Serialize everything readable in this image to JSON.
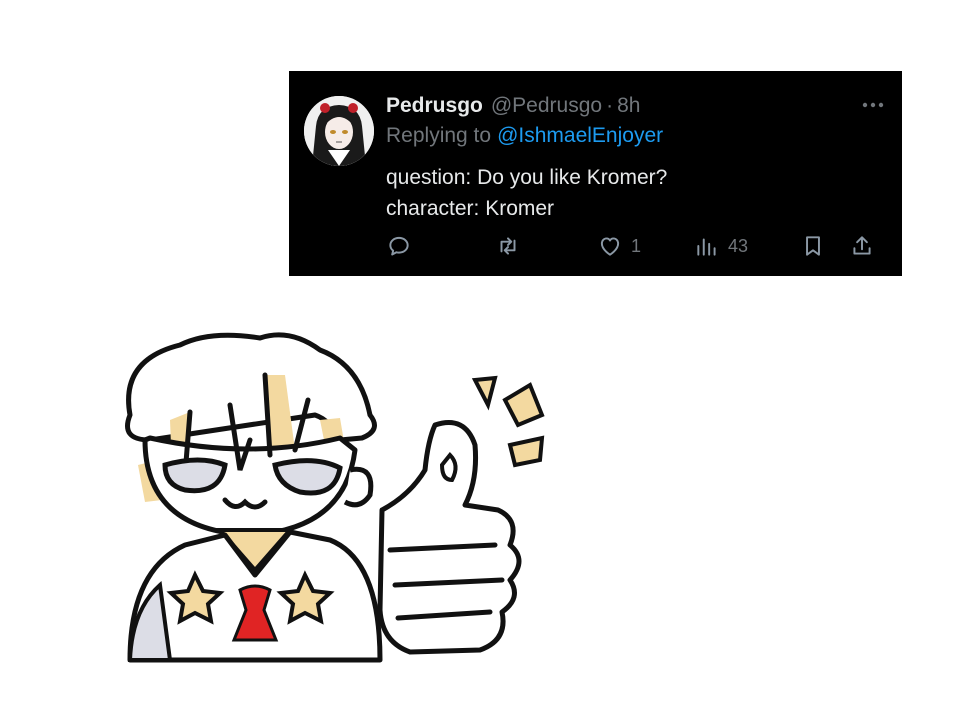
{
  "tweet": {
    "display_name": "Pedrusgo",
    "handle": "@Pedrusgo",
    "separator": "·",
    "time": "8h",
    "replying_prefix": "Replying to",
    "replying_to": "@IshmaelEnjoyer",
    "lines": [
      "question: Do you like Kromer?",
      "character: Kromer"
    ],
    "actions": {
      "reply_count": "",
      "retweet_count": "",
      "like_count": "1",
      "views_count": "43"
    }
  },
  "icons": [
    "reply-icon",
    "retweet-icon",
    "heart-icon",
    "views-icon",
    "bookmark-icon",
    "share-icon",
    "more-icon"
  ],
  "colors": {
    "tweet_background": "#000000",
    "text_primary": "#e7e9ea",
    "text_secondary": "#71767b",
    "mention": "#1d9bf0",
    "hair": "#f3d9a0",
    "bow": "#e02424"
  }
}
